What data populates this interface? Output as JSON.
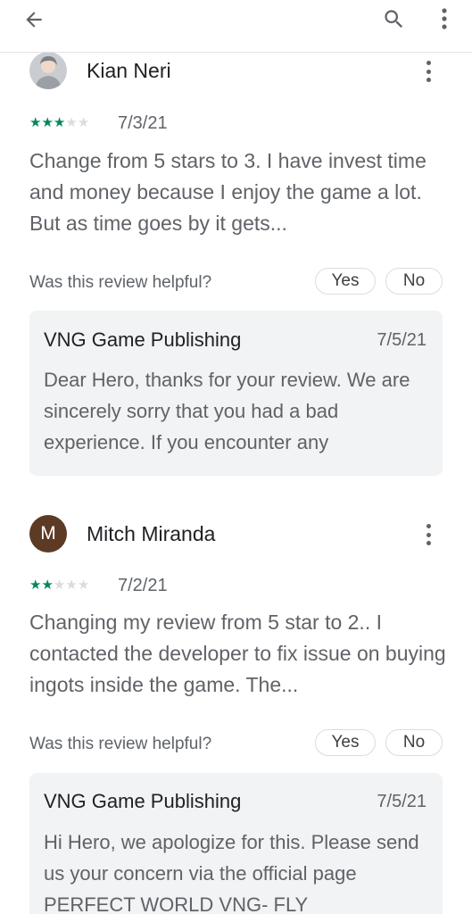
{
  "toolbar": {
    "back_icon": "arrow-left-icon",
    "search_icon": "search-icon",
    "more_icon": "more-vert-icon"
  },
  "colors": {
    "star_filled": "#01875f",
    "star_empty": "#dadce0",
    "dev_reply_bg": "#f1f3f4",
    "avatar_m_bg": "#5d3a24"
  },
  "reviews": [
    {
      "reviewer": "Kian Neri",
      "avatar_letter": "",
      "rating": 3,
      "rating_max": 5,
      "date": "7/3/21",
      "text": "Change from 5 stars to 3. I have invest time and money because I enjoy the game a lot. But as time goes by it gets...",
      "helpful_question": "Was this review helpful?",
      "yes_label": "Yes",
      "no_label": "No",
      "developer_reply": {
        "developer": "VNG Game Publishing",
        "date": "7/5/21",
        "text": "Dear Hero, thanks for your review. We are sincerely sorry that you had a bad experience. If you encounter any"
      }
    },
    {
      "reviewer": "Mitch Miranda",
      "avatar_letter": "M",
      "rating": 2,
      "rating_max": 5,
      "date": "7/2/21",
      "text": "Changing my review from 5 star to 2.. I contacted the developer to fix issue on buying ingots inside the game. The...",
      "helpful_question": "Was this review helpful?",
      "yes_label": "Yes",
      "no_label": "No",
      "developer_reply": {
        "developer": "VNG Game Publishing",
        "date": "7/5/21",
        "text": "Hi Hero, we apologize for this. Please send us your concern via the official page PERFECT WORLD VNG- FLY"
      }
    }
  ]
}
